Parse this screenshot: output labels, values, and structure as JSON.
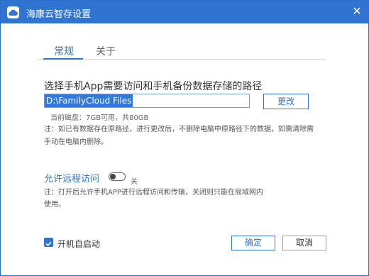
{
  "window": {
    "title": "海康云智存设置",
    "close_glyph": "✕"
  },
  "tabs": [
    {
      "label": "常规",
      "active": true
    },
    {
      "label": "关于",
      "active": false
    }
  ],
  "storage": {
    "heading": "选择手机App需要访问和手机备份数据存储的路径",
    "path_value": "D:\\FamilyCloud Files",
    "change_button": "更改",
    "disk_info": "当前磁盘：7GB可用，共80GB",
    "note": "注：如已有数据存在原路径，进行更改后，不删除电脑中原路径下的数据，如需清除需手动在电脑内删除。"
  },
  "remote": {
    "label": "允许远程访问",
    "toggle_state": "关",
    "note": "注：打开后允许手机APP进行远程访问和传输，关闭则只能在局域网内使用。"
  },
  "autostart": {
    "label": "开机自启动",
    "checked": true
  },
  "buttons": {
    "ok": "确定",
    "cancel": "取消"
  },
  "colors": {
    "accent": "#2f74d0",
    "titlebar": "#2f74d0"
  },
  "icons": {
    "app": "cloud-icon",
    "close": "close-icon",
    "checkbox": "checkmark-icon"
  }
}
